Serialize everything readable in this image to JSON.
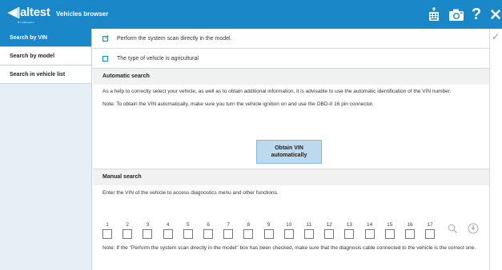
{
  "header": {
    "logo_text": "◀|altest",
    "logo_sub": "BY HOGAALL",
    "title": "Vehicles browser",
    "icons": [
      "keyboard-icon",
      "camera-icon",
      "help-icon",
      "close-icon"
    ],
    "accent": "#1a87c8"
  },
  "sidebar": {
    "items": [
      {
        "label": "Search by VIN",
        "active": true
      },
      {
        "label": "Search by model",
        "active": false
      },
      {
        "label": "Search in vehicle list",
        "active": false
      }
    ]
  },
  "options": {
    "scan_label": "Perform the system scan directly in the model.",
    "scan_checked": true,
    "agri_label": "The type of vehicle is agricultural",
    "agri_checked": false
  },
  "automatic": {
    "heading": "Automatic search",
    "para1": "As a help to correctly select your vehicle, as well as to obtain additional information, it is advisable to use the automatic identification of the VIN number.",
    "note": "Note: To obtain the VIN automatically, make sure you turn the vehicle ignition on and use the OBD-II 16 pin connector.",
    "button_label": "Obtain VIN automatically"
  },
  "manual": {
    "heading": "Manual search",
    "instruction": "Enter the VIN of the vehicle to access diagnostics menu and other functions.",
    "positions": [
      "1",
      "2",
      "3",
      "4",
      "5",
      "6",
      "7",
      "8",
      "9",
      "10",
      "11",
      "12",
      "13",
      "14",
      "15",
      "16",
      "17"
    ],
    "note": "Note: If the \"Perform the system scan directly in the model\" box has been checked, make sure that the diagnosis cable connected to the vehicle is the correct one."
  }
}
